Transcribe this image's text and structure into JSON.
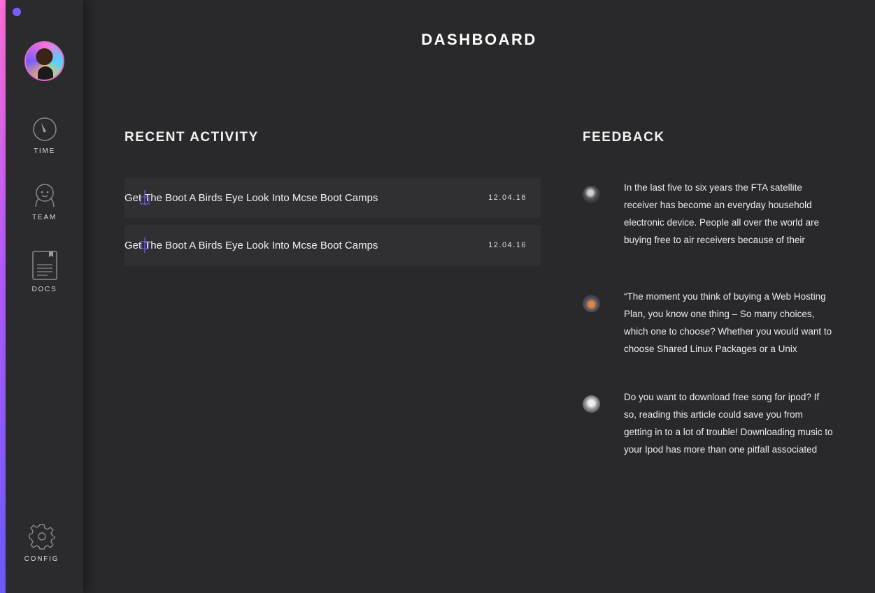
{
  "page": {
    "title": "DASHBOARD"
  },
  "sidebar": {
    "items": [
      {
        "label": "TIME",
        "icon": "stopwatch-icon"
      },
      {
        "label": "TEAM",
        "icon": "person-icon"
      },
      {
        "label": "DOCS",
        "icon": "document-icon"
      },
      {
        "label": "CONFIG",
        "icon": "gear-icon"
      }
    ]
  },
  "recent_activity": {
    "title": "RECENT ACTIVITY",
    "rows": [
      {
        "text": "Get The Boot A Birds Eye Look Into Mcse Boot Camps",
        "date": "12.04.16"
      },
      {
        "text": "Get The Boot A Birds Eye Look Into Mcse Boot Camps",
        "date": "12.04.16"
      }
    ]
  },
  "feedback": {
    "title": "FEEDBACK",
    "items": [
      {
        "text": "In the last five to six years the FTA satellite receiver has become an everyday household electronic device. People all over the world are buying free to air receivers because of their"
      },
      {
        "text": "“The moment you think of buying a Web Hosting Plan, you know one thing – So many choices, which one to choose? Whether you would want to choose Shared Linux Packages or a Unix"
      },
      {
        "text": "Do you want to download free song for ipod? If so, reading this article could save you from getting in to a lot of trouble! Downloading music to your Ipod has more than one pitfall associated"
      }
    ]
  },
  "colors": {
    "background": "#29282a",
    "sidebar": "#2b2a2c",
    "row": "#302f31",
    "accent": "#7b5cff",
    "accent_pink": "#ff6fd8"
  }
}
